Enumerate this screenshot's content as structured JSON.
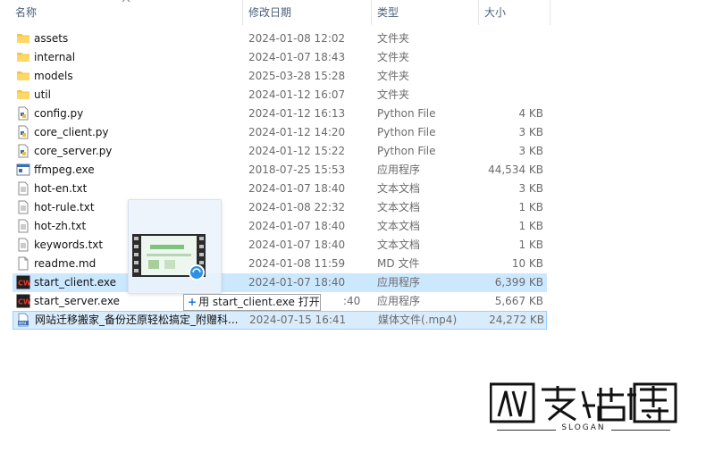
{
  "columns": {
    "name": "名称",
    "date": "修改日期",
    "type": "类型",
    "size": "大小"
  },
  "files": [
    {
      "name": "assets",
      "date": "2024-01-08 12:02",
      "type": "文件夹",
      "size": "",
      "icon": "folder-icon"
    },
    {
      "name": "internal",
      "date": "2024-01-07 18:43",
      "type": "文件夹",
      "size": "",
      "icon": "folder-icon"
    },
    {
      "name": "models",
      "date": "2025-03-28 15:28",
      "type": "文件夹",
      "size": "",
      "icon": "folder-icon"
    },
    {
      "name": "util",
      "date": "2024-01-12 16:07",
      "type": "文件夹",
      "size": "",
      "icon": "folder-icon"
    },
    {
      "name": "config.py",
      "date": "2024-01-12 16:13",
      "type": "Python File",
      "size": "4 KB",
      "icon": "python-file-icon"
    },
    {
      "name": "core_client.py",
      "date": "2024-01-12 14:20",
      "type": "Python File",
      "size": "3 KB",
      "icon": "python-file-icon"
    },
    {
      "name": "core_server.py",
      "date": "2024-01-12 15:22",
      "type": "Python File",
      "size": "3 KB",
      "icon": "python-file-icon"
    },
    {
      "name": "ffmpeg.exe",
      "date": "2018-07-25 15:53",
      "type": "应用程序",
      "size": "44,534 KB",
      "icon": "exe-icon"
    },
    {
      "name": "hot-en.txt",
      "date": "2024-01-07 18:40",
      "type": "文本文档",
      "size": "3 KB",
      "icon": "text-file-icon"
    },
    {
      "name": "hot-rule.txt",
      "date": "2024-01-08 22:32",
      "type": "文本文档",
      "size": "1 KB",
      "icon": "text-file-icon"
    },
    {
      "name": "hot-zh.txt",
      "date": "2024-01-07 18:40",
      "type": "文本文档",
      "size": "1 KB",
      "icon": "text-file-icon"
    },
    {
      "name": "keywords.txt",
      "date": "2024-01-07 18:40",
      "type": "文本文档",
      "size": "1 KB",
      "icon": "text-file-icon"
    },
    {
      "name": "readme.md",
      "date": "2024-01-08 11:59",
      "type": "MD 文件",
      "size": "10 KB",
      "icon": "md-file-icon"
    },
    {
      "name": "start_client.exe",
      "date": "2024-01-07 18:40",
      "type": "应用程序",
      "size": "6,399 KB",
      "icon": "cw-app-icon"
    },
    {
      "name": "start_server.exe",
      "date": ":40",
      "type": "应用程序",
      "size": "5,667 KB",
      "icon": "cw-app-icon"
    },
    {
      "name": "网站迁移搬家_备份还原轻松搞定_附赠科...",
      "date": "2024-07-15 16:41",
      "type": "媒体文件(.mp4)",
      "size": "24,272 KB",
      "icon": "mp4-file-icon"
    }
  ],
  "tooltip": {
    "plus": "+",
    "text": "用 start_client.exe 打开"
  },
  "logo": {
    "slogan": "SLOGAN"
  },
  "colors": {
    "selection": "#cce8ff",
    "folder": "#f4c542",
    "cw_red": "#d9281c"
  }
}
